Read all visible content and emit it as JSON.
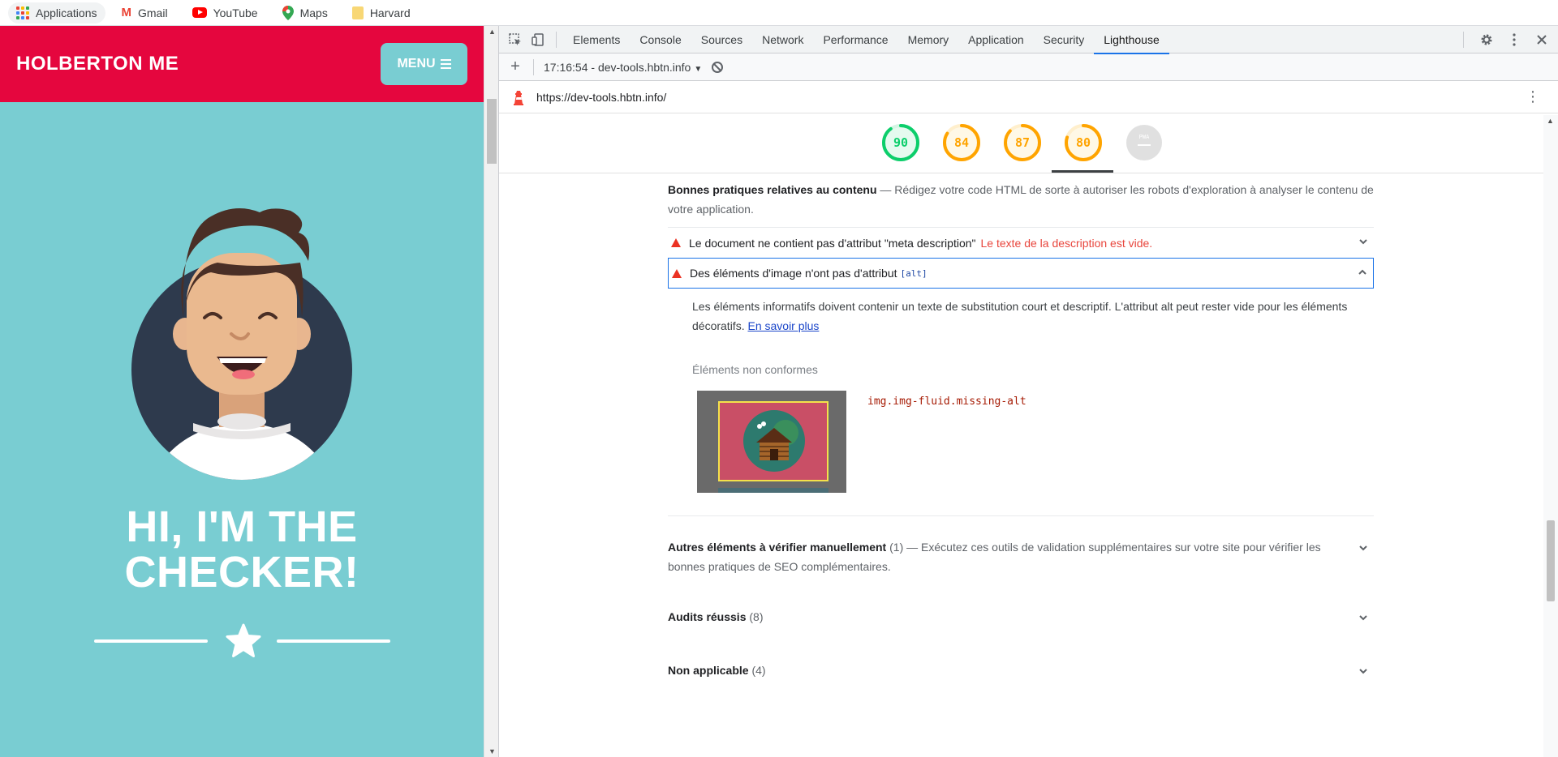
{
  "bookmarks": [
    {
      "label": "Applications",
      "icon": "apps-grid-icon"
    },
    {
      "label": "Gmail",
      "icon": "gmail-icon"
    },
    {
      "label": "YouTube",
      "icon": "youtube-icon"
    },
    {
      "label": "Maps",
      "icon": "maps-icon"
    },
    {
      "label": "Harvard",
      "icon": "folder-icon"
    }
  ],
  "page": {
    "brand": "HOLBERTON ME",
    "menu_label": "MENU",
    "hero_line1": "HI, I'M THE",
    "hero_line2": "CHECKER!",
    "colors": {
      "nav": "#e5063e",
      "bg": "#79cdd2"
    }
  },
  "devtools": {
    "tabs": [
      "Elements",
      "Console",
      "Sources",
      "Network",
      "Performance",
      "Memory",
      "Application",
      "Security",
      "Lighthouse"
    ],
    "active_tab": "Lighthouse",
    "report_label": "17:16:54 - dev-tools.hbtn.info",
    "url": "https://dev-tools.hbtn.info/"
  },
  "gauges": [
    {
      "score": "90",
      "value": 0.9,
      "color": "#0cce6b"
    },
    {
      "score": "84",
      "value": 0.84,
      "color": "#ffa400"
    },
    {
      "score": "87",
      "value": 0.87,
      "color": "#ffa400"
    },
    {
      "score": "80",
      "value": 0.8,
      "color": "#ffa400"
    },
    {
      "score": "PWA",
      "value": 0,
      "color": "#9aa0a6"
    }
  ],
  "content": {
    "section_title": "Bonnes pratiques relatives au contenu",
    "section_desc": " — Rédigez votre code HTML de sorte à autoriser les robots d'exploration à analyser le contenu de votre application.",
    "audit1_text": "Le document ne contient pas d'attribut \"meta description\"",
    "audit1_error": "Le texte de la description est vide.",
    "audit2_text": "Des éléments d'image n'ont pas d'attribut",
    "audit2_code": "[alt]",
    "detail_text": "Les éléments informatifs doivent contenir un texte de substitution court et descriptif. L'attribut alt peut rester vide pour les éléments décoratifs.",
    "detail_link": "En savoir plus",
    "nonconf_label": "Éléments non conformes",
    "selector": "img.img-fluid.missing-alt",
    "group1_title": "Autres éléments à vérifier manuellement",
    "group1_count": "(1)",
    "group1_desc": " — Exécutez ces outils de validation supplémentaires sur votre site pour vérifier les bonnes pratiques de SEO complémentaires.",
    "group2_title": "Audits réussis",
    "group2_count": "(8)",
    "group3_title": "Non applicable",
    "group3_count": "(4)"
  }
}
